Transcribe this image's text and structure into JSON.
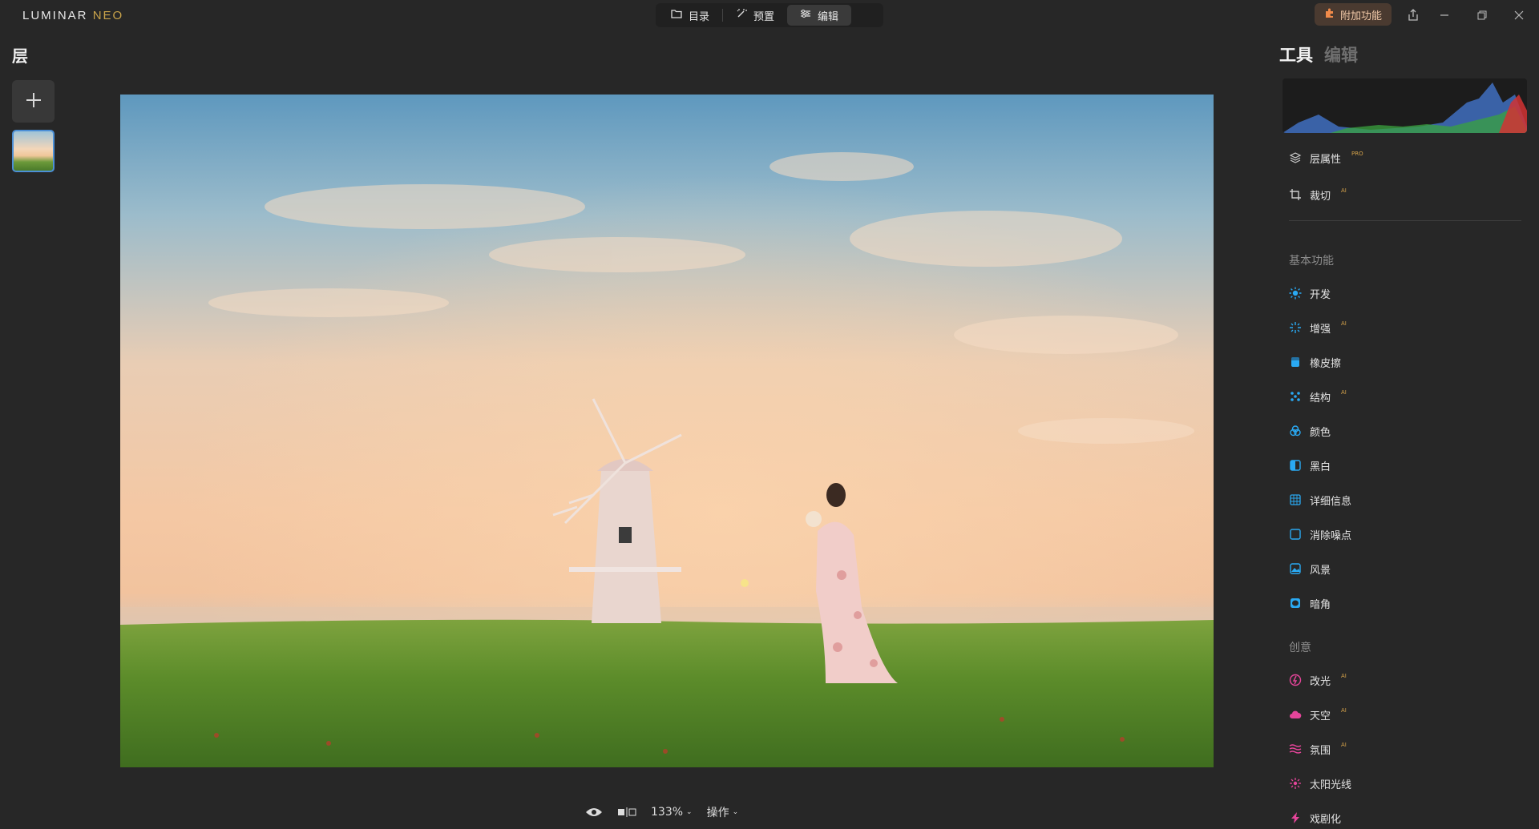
{
  "app": {
    "logo_main": "LUMINAR",
    "logo_neo": "NEO"
  },
  "tabs": [
    {
      "label": "目录",
      "icon": "folder-icon"
    },
    {
      "label": "预置",
      "icon": "magic-wand-icon"
    },
    {
      "label": "编辑",
      "icon": "sliders-icon",
      "active": true
    }
  ],
  "addon": {
    "label": "附加功能",
    "icon": "puzzle-icon"
  },
  "window_controls": [
    "share-icon",
    "minimize-icon",
    "restore-icon",
    "close-icon"
  ],
  "layers": {
    "title": "层"
  },
  "bottom": {
    "zoom": "133%",
    "actions": "操作"
  },
  "right_panel": {
    "tabs": [
      {
        "label": "工具",
        "active": true
      },
      {
        "label": "编辑",
        "active": false
      }
    ],
    "top_tools": [
      {
        "label": "层属性",
        "badge": "PRO",
        "icon": "layers-icon"
      },
      {
        "label": "裁切",
        "badge": "AI",
        "icon": "crop-icon"
      }
    ],
    "sections": [
      {
        "title": "基本功能",
        "items": [
          {
            "label": "开发",
            "badge": "",
            "icon": "sun-icon",
            "color": "#2aa9f2"
          },
          {
            "label": "增强",
            "badge": "AI",
            "icon": "sparkle-icon",
            "color": "#2aa9f2"
          },
          {
            "label": "橡皮擦",
            "badge": "",
            "icon": "eraser-icon",
            "color": "#2aa9f2"
          },
          {
            "label": "结构",
            "badge": "AI",
            "icon": "structure-icon",
            "color": "#2aa9f2"
          },
          {
            "label": "颜色",
            "badge": "",
            "icon": "color-icon",
            "color": "#2aa9f2"
          },
          {
            "label": "黑白",
            "badge": "",
            "icon": "bw-icon",
            "color": "#2aa9f2"
          },
          {
            "label": "详细信息",
            "badge": "",
            "icon": "details-icon",
            "color": "#2aa9f2"
          },
          {
            "label": "消除噪点",
            "badge": "",
            "icon": "denoise-icon",
            "color": "#2aa9f2"
          },
          {
            "label": "风景",
            "badge": "",
            "icon": "landscape-icon",
            "color": "#2aa9f2"
          },
          {
            "label": "暗角",
            "badge": "",
            "icon": "vignette-icon",
            "color": "#2aa9f2"
          }
        ]
      },
      {
        "title": "创意",
        "items": [
          {
            "label": "改光",
            "badge": "AI",
            "icon": "relight-icon",
            "color": "#e5459a"
          },
          {
            "label": "天空",
            "badge": "AI",
            "icon": "cloud-icon",
            "color": "#e5459a"
          },
          {
            "label": "氛围",
            "badge": "AI",
            "icon": "atmosphere-icon",
            "color": "#e5459a"
          },
          {
            "label": "太阳光线",
            "badge": "",
            "icon": "sunrays-icon",
            "color": "#e5459a"
          },
          {
            "label": "戏剧化",
            "badge": "",
            "icon": "lightning-icon",
            "color": "#e5459a"
          }
        ]
      }
    ]
  }
}
